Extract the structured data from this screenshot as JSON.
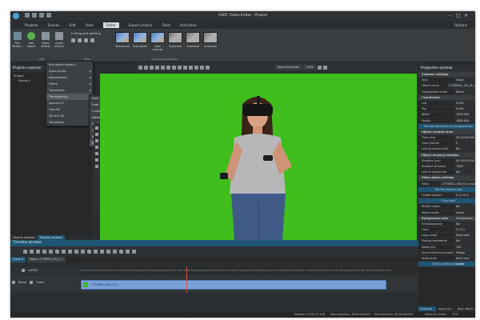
{
  "window": {
    "title": "VSDC Video Editor - Project"
  },
  "menu": {
    "items": [
      "Projects",
      "Scenes",
      "Edit",
      "View",
      "Editor",
      "Export project",
      "Tools",
      "Activation"
    ],
    "active": "Editor",
    "options": "Options"
  },
  "ribbon": {
    "tools": [
      {
        "label": "Run Wizard...",
        "icon": "wand-icon"
      },
      {
        "label": "Add object",
        "icon": "plus-circle-icon"
      },
      {
        "label": "Video effects",
        "icon": "video-fx-icon"
      },
      {
        "label": "Audio effects",
        "icon": "audio-fx-icon"
      }
    ],
    "cutting": "Cutting and splitting",
    "tools_group": "Tools",
    "edit_group": "Edit",
    "quick_styles": [
      "Remove all",
      "Auto levels",
      "Auto contrast",
      "Grayscale",
      "Grayscale",
      "Grayscale"
    ],
    "quick_group": "Choosing quick style"
  },
  "projects_explorer": {
    "title": "Projects explorer",
    "tree": [
      "Project",
      "Scene 0"
    ],
    "tabs": [
      "Objects explorer",
      "Projects explorer"
    ]
  },
  "video_effects_menu": {
    "items": [
      "Run object wizard...",
      "Quick styles",
      "Adjustments",
      "Filters",
      "Transforms",
      "Transparency",
      "Special FX",
      "OpenGL",
      "3D and 3D",
      "Transitions"
    ]
  },
  "transparency_menu": {
    "items": [
      "Fade in",
      "Fade out",
      "Custom transparency",
      "Matte opaque",
      "Matte transparent",
      "Clipping",
      "Borders",
      "Background remover"
    ]
  },
  "preview_toolbar": {
    "zoom": "Zoom To Screen",
    "zoom_pct": "100%"
  },
  "properties": {
    "title": "Properties window",
    "rows": [
      {
        "k": "Common settings",
        "v": "",
        "type": "sec"
      },
      {
        "k": "Type",
        "v": "Video"
      },
      {
        "k": "Object name",
        "v": "17736551_052_R_1"
      },
      {
        "k": "Composition mode",
        "v": "Blend"
      },
      {
        "k": "Coordinates",
        "v": "",
        "type": "sec"
      },
      {
        "k": "Left",
        "v": "0.000"
      },
      {
        "k": "Top",
        "v": "0.000"
      },
      {
        "k": "Width",
        "v": "1920.000"
      },
      {
        "k": "Height",
        "v": "1080.000"
      },
      {
        "k": "Set the same size as the parent has",
        "v": "",
        "type": "btn"
      },
      {
        "k": "Object creation time",
        "v": "",
        "type": "sec"
      },
      {
        "k": "Time (ms)",
        "v": "00:00:00.000"
      },
      {
        "k": "Time (frame)",
        "v": "0"
      },
      {
        "k": "Lock to parent start",
        "v": "No"
      },
      {
        "k": "Object drawing duration",
        "v": "",
        "type": "sec"
      },
      {
        "k": "Duration (ms)",
        "v": "00:00:23.000"
      },
      {
        "k": "Duration (frames)",
        "v": "1380"
      },
      {
        "k": "Lock to parent dur.",
        "v": "No"
      },
      {
        "k": "Video object settings",
        "v": "",
        "type": "sec"
      },
      {
        "k": "Video",
        "v": "17736551_052_R_1.mp4"
      },
      {
        "k": "Set the original size",
        "v": "",
        "type": "btn"
      },
      {
        "k": "Cutted borders",
        "v": "0; 0; 0; 0"
      },
      {
        "k": "Crop tools",
        "v": "",
        "type": "btn"
      },
      {
        "k": "Stretch video",
        "v": "No"
      },
      {
        "k": "Resize mode",
        "v": "Linear interpolation"
      },
      {
        "k": "Background color",
        "v": "",
        "type": "sec"
      },
      {
        "k": "Fill background",
        "v": "No"
      },
      {
        "k": "Color",
        "v": "0; 0; 0"
      },
      {
        "k": "Loop mode",
        "v": "Show last frame at the end"
      },
      {
        "k": "Playing backwards",
        "v": "No"
      },
      {
        "k": "Speed (%)",
        "v": "100"
      },
      {
        "k": "Sound stretching mode",
        "v": "Tempo change"
      },
      {
        "k": "Audio track",
        "v": "Don't use audio"
      },
      {
        "k": "Split to video and audio",
        "v": "",
        "type": "btn"
      }
    ],
    "tabs": [
      "Properties w...",
      "Resources w...",
      "Basic effects ..."
    ]
  },
  "timeline": {
    "title": "Timeline window",
    "scene_tab": "Scene 0",
    "clip_tab": "Video: 17736551_052_R_1",
    "layers_label": "LAYERS",
    "track_blend": "Blend",
    "track_type": "Video",
    "clip_name": "17736551_052_R_1",
    "ruler": "00:00.000  00:01.000  00:02.000  00:03.000  00:04.000  00:05.000  00:06.000  00:07.000  00:08.000  00:09.000  00:10.000  00:11.000  00:12.000  00:13.000  00:14.000  00:15.000  00:16.000  00:17.000  00:18.000  00:19.000  00:20.000  00:21.000  00:22.000  00:23.000"
  },
  "status": {
    "position": "Position:  00:00:07.016",
    "start_sel": "Start selection:  00:00:00.000",
    "end_sel": "End selection:  00:00:00.000",
    "zoom": "Zoom To Screen",
    "pct": "75%"
  },
  "colors": {
    "accent": "#1f5572",
    "chroma": "#3fbe1e",
    "clip": "#7aa0d8"
  }
}
